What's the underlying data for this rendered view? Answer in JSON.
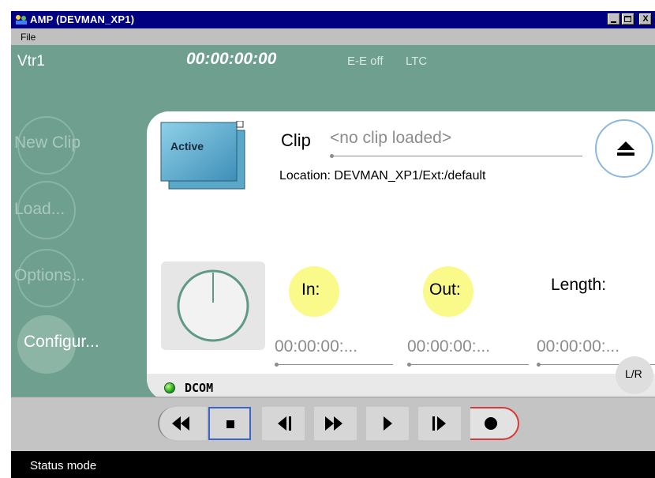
{
  "window": {
    "title": "AMP (DEVMAN_XP1)",
    "controls": [
      "minimize",
      "maximize",
      "close"
    ],
    "close_glyph": "X"
  },
  "menu": {
    "file": "File"
  },
  "header": {
    "device": "Vtr1",
    "timecode": "00:00:00:00",
    "ee_status": "E-E off",
    "timecode_source": "LTC"
  },
  "side_buttons": [
    {
      "label": "New Clip",
      "active": false
    },
    {
      "label": "Load...",
      "active": false
    },
    {
      "label": "Options...",
      "active": false
    },
    {
      "label": "Configur...",
      "active": true
    }
  ],
  "clip": {
    "active_label": "Active",
    "clip_label": "Clip",
    "clip_value": "<no clip loaded>",
    "location": "Location: DEVMAN_XP1/Ext:/default"
  },
  "marks": {
    "in_label": "In:",
    "out_label": "Out:",
    "length_label": "Length:",
    "in_value": "00:00:00:...",
    "out_value": "00:00:00:...",
    "length_value": "00:00:00:..."
  },
  "connection": {
    "label": "DCOM",
    "status_color": "#22aa22"
  },
  "lr_button": "L/R",
  "transport": [
    "rewind",
    "stop",
    "step-back",
    "fast-forward",
    "play",
    "step-forward",
    "record"
  ],
  "statusbar": {
    "text": "Status mode"
  },
  "colors": {
    "panel": "#6f9f8e",
    "accent_blue": "#3a64c8",
    "mark_yellow": "#fafa8a",
    "record_red": "#d83a3a"
  }
}
